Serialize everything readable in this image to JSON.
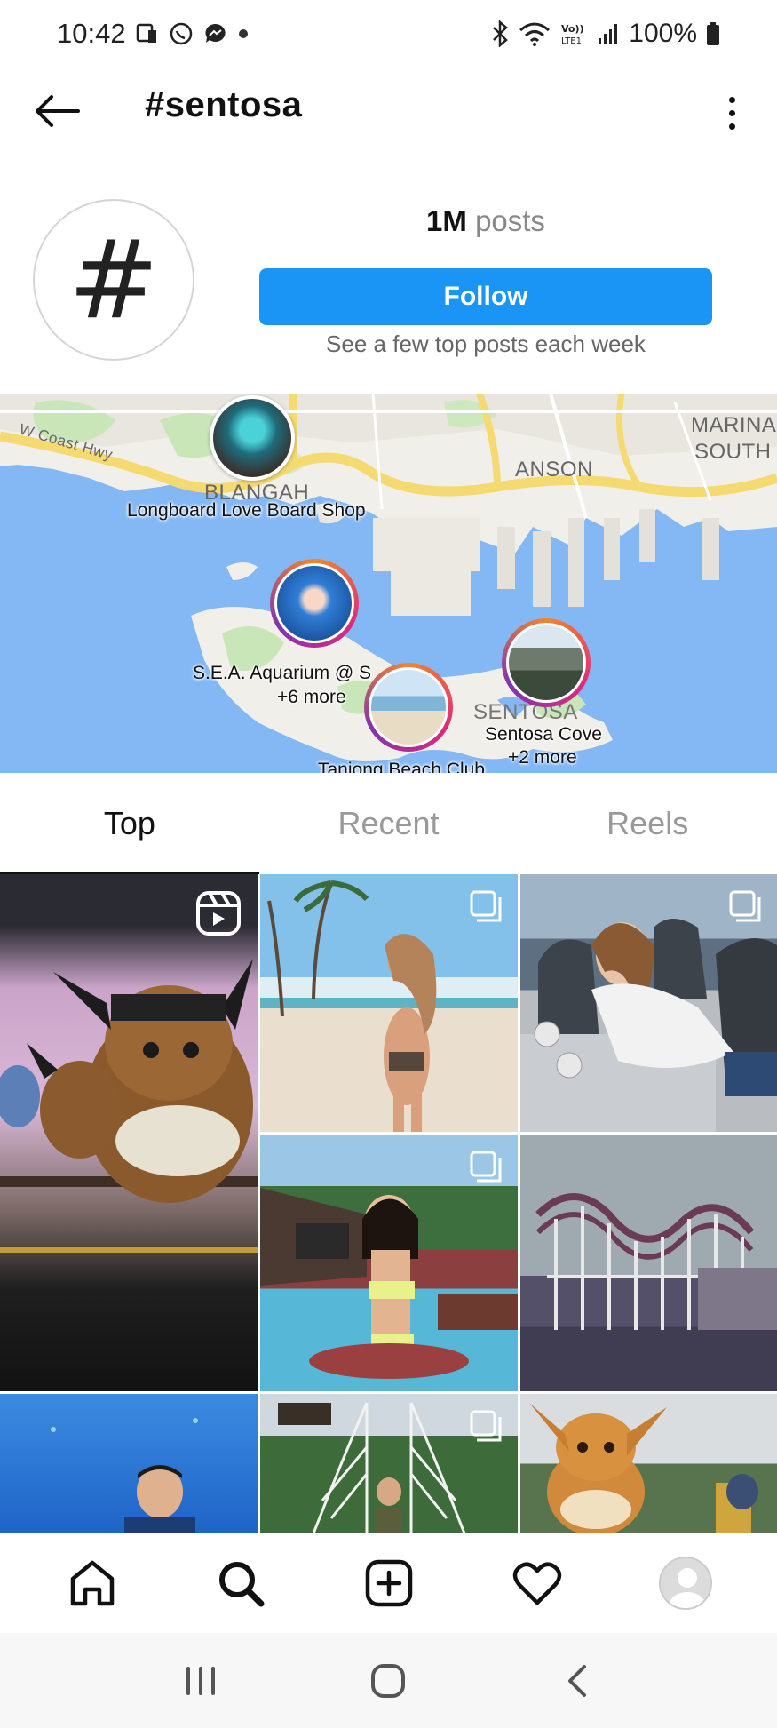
{
  "status_bar": {
    "time": "10:42",
    "battery": "100%",
    "icons_left": [
      "notification-icon",
      "whatsapp-icon",
      "messenger-icon",
      "dot-icon"
    ],
    "icons_right": [
      "bluetooth-icon",
      "wifi-icon",
      "volte-icon",
      "signal-icon",
      "battery-icon"
    ]
  },
  "header": {
    "title": "#sentosa",
    "back_icon": "arrow-left-icon",
    "more_icon": "vertical-dots-icon"
  },
  "profile": {
    "avatar_symbol": "#",
    "posts_count": "1M",
    "posts_label": "posts",
    "follow_label": "Follow",
    "follow_subtitle": "See a few top posts each week"
  },
  "map": {
    "area_labels": [
      "BLANGAH",
      "ANSON",
      "MARINA",
      "SOUTH",
      "W Coast Hwy",
      "SENTOSA"
    ],
    "pins": [
      {
        "label": "Longboard Love Board Shop",
        "extra": ""
      },
      {
        "label": "S.E.A. Aquarium @ S",
        "extra": "+6 more"
      },
      {
        "label": "Tanjong Beach Club",
        "extra": ""
      },
      {
        "label": "Sentosa Cove",
        "extra": "+2 more"
      }
    ]
  },
  "tabs": [
    {
      "label": "Top",
      "active": true
    },
    {
      "label": "Recent",
      "active": false
    },
    {
      "label": "Reels",
      "active": false
    }
  ],
  "grid_tiles": [
    {
      "badge": "reel-icon",
      "description": "pikachu-stage"
    },
    {
      "badge": "carousel-icon",
      "description": "beach"
    },
    {
      "badge": "carousel-icon",
      "description": "cafe"
    },
    {
      "badge": "carousel-icon",
      "description": "pool"
    },
    {
      "badge": "",
      "description": "rollercoaster"
    },
    {
      "badge": "",
      "description": "aquarium"
    },
    {
      "badge": "carousel-icon",
      "description": "rope-bridge"
    },
    {
      "badge": "",
      "description": "eevee-statue"
    }
  ],
  "bottom_nav": [
    "home-icon",
    "search-icon",
    "add-post-icon",
    "heart-icon",
    "profile-avatar"
  ],
  "system_nav": [
    "recent-apps-icon",
    "home-button-icon",
    "back-icon"
  ]
}
